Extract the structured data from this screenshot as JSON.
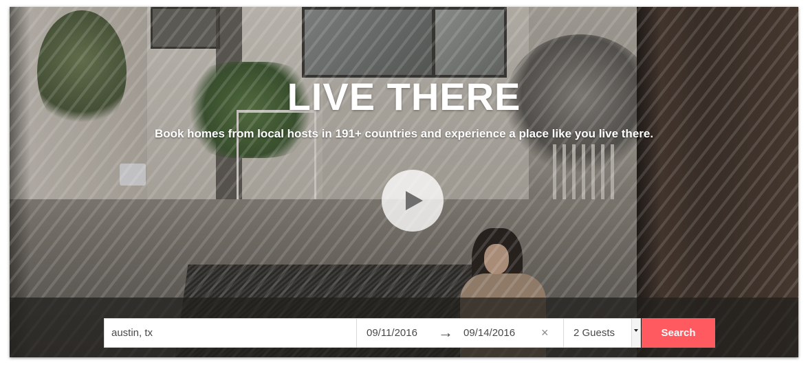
{
  "hero": {
    "title": "LIVE THERE",
    "subtitle": "Book homes from local hosts in 191+ countries and experience a place like you live there.",
    "play_icon": "play-icon"
  },
  "search": {
    "location_value": "austin, tx",
    "checkin": "09/11/2016",
    "arrow": "→",
    "checkout": "09/14/2016",
    "clear": "×",
    "guests": "2 Guests",
    "button_label": "Search"
  },
  "colors": {
    "accent": "#ff5a5f",
    "text": "#484848",
    "overlay": "#201e1c"
  }
}
